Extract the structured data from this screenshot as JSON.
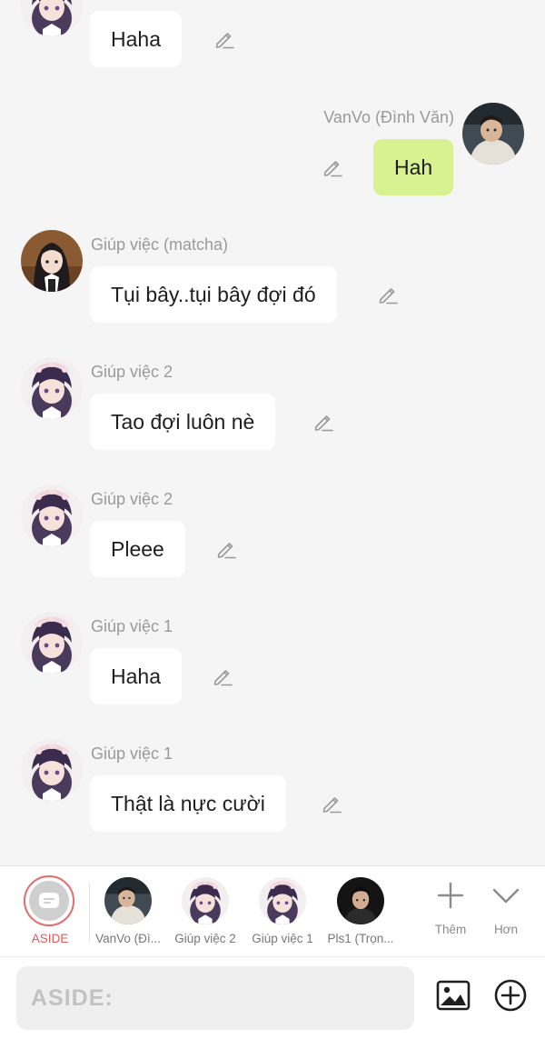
{
  "messages": [
    {
      "sender": "",
      "text": "Haha",
      "side": "left"
    },
    {
      "sender": "VanVo (Đình Văn)",
      "text": "Hah",
      "side": "right"
    },
    {
      "sender": "Giúp việc (matcha)",
      "text": "Tụi bây..tụi bây đợi đó",
      "side": "left"
    },
    {
      "sender": "Giúp việc 2",
      "text": "Tao đợi luôn nè",
      "side": "left"
    },
    {
      "sender": "Giúp việc 2",
      "text": "Pleee",
      "side": "left"
    },
    {
      "sender": "Giúp việc 1",
      "text": "Haha",
      "side": "left"
    },
    {
      "sender": "Giúp việc 1",
      "text": "Thật là nực cười",
      "side": "left"
    }
  ],
  "character_tray": {
    "aside_label": "ASIDE",
    "characters": [
      {
        "label": "VanVo (Đì..."
      },
      {
        "label": "Giúp việc 2"
      },
      {
        "label": "Giúp việc 1"
      },
      {
        "label": "Pls1 (Trọn..."
      }
    ],
    "more_label": "Thêm",
    "collapse_label": "Hơn"
  },
  "composer": {
    "placeholder": "ASIDE:"
  },
  "colors": {
    "my_bubble": "#d8f292",
    "other_bubble": "#ffffff",
    "aside_accent": "#e05a5a",
    "background": "#f5f5f5"
  },
  "icons": [
    "edit-icon",
    "plus-icon",
    "chevron-down-icon",
    "image-icon",
    "add-circle-icon",
    "chat-bubble-icon"
  ]
}
